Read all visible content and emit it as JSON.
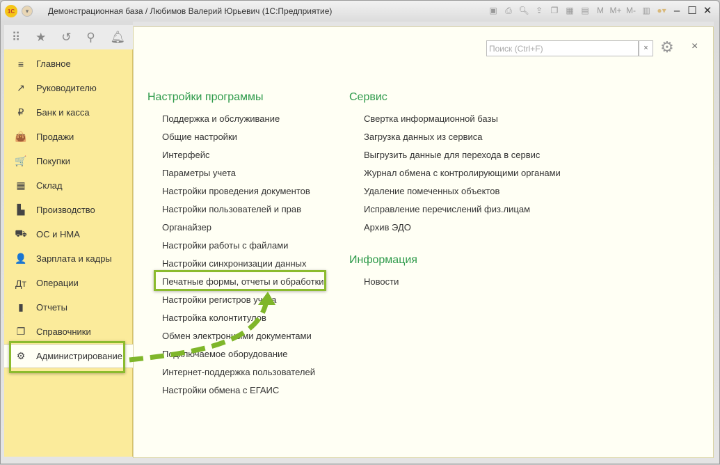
{
  "window": {
    "title": "Демонстрационная база / Любимов Валерий Юрьевич  (1С:Предприятие)",
    "logo": "1С",
    "tools": [
      "save-icon",
      "print-icon",
      "preview-icon",
      "upload-icon",
      "copy-icon",
      "calculator-icon",
      "calendar-icon",
      "M",
      "M+",
      "M-",
      "panel-icon",
      "info-icon"
    ],
    "controls": [
      "–",
      "☐",
      "✕"
    ]
  },
  "sidebar": {
    "top_icons": [
      "apps-icon",
      "star-icon",
      "history-icon",
      "search-icon",
      "bell-icon"
    ],
    "items": [
      {
        "label": "Главное",
        "icon": "≡"
      },
      {
        "label": "Руководителю",
        "icon": "↗"
      },
      {
        "label": "Банк и касса",
        "icon": "₽"
      },
      {
        "label": "Продажи",
        "icon": "👜"
      },
      {
        "label": "Покупки",
        "icon": "🛒"
      },
      {
        "label": "Склад",
        "icon": "▦"
      },
      {
        "label": "Производство",
        "icon": "▙"
      },
      {
        "label": "ОС и НМА",
        "icon": "⛟"
      },
      {
        "label": "Зарплата и кадры",
        "icon": "👤"
      },
      {
        "label": "Операции",
        "icon": "Дт"
      },
      {
        "label": "Отчеты",
        "icon": "▮"
      },
      {
        "label": "Справочники",
        "icon": "❐"
      },
      {
        "label": "Администрирование",
        "icon": "⚙"
      }
    ]
  },
  "search": {
    "placeholder": "Поиск (Ctrl+F)",
    "clear": "×"
  },
  "settings": {
    "heading": "Настройки программы",
    "links": [
      "Поддержка и обслуживание",
      "Общие настройки",
      "Интерфейс",
      "Параметры учета",
      "Настройки проведения документов",
      "Настройки пользователей и прав",
      "Органайзер",
      "Настройки работы с файлами",
      "Настройки синхронизации данных",
      "Печатные формы, отчеты и обработки",
      "Настройки регистров учета",
      "Настройка колонтитулов",
      "Обмен электронными документами",
      "Подключаемое оборудование",
      "Интернет-поддержка пользователей",
      "Настройки обмена с ЕГАИС"
    ]
  },
  "service": {
    "heading": "Сервис",
    "links": [
      "Свертка информационной базы",
      "Загрузка данных из сервиса",
      "Выгрузить данные для перехода в сервис",
      "Журнал обмена с контролирующими органами",
      "Удаление помеченных объектов",
      "Исправление перечислений физ.лицам",
      "Архив ЭДО"
    ]
  },
  "info": {
    "heading": "Информация",
    "links": [
      "Новости"
    ]
  },
  "colors": {
    "accent": "#2d9a4a",
    "highlight": "#8bbb2e",
    "sidebar": "#fbeb9b"
  }
}
